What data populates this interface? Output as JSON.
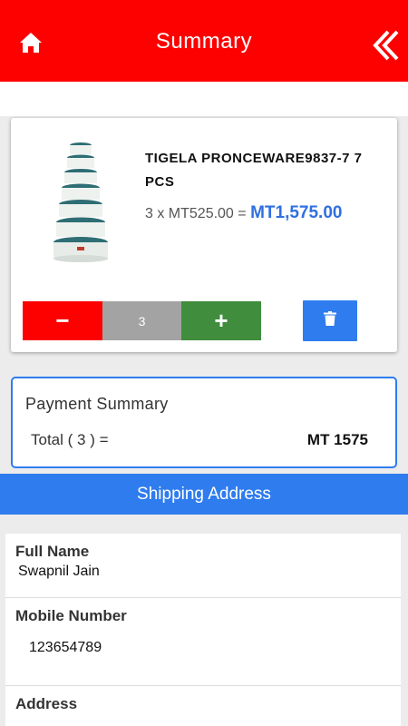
{
  "header": {
    "title": "Summary",
    "home_icon": "home-icon",
    "back_icon": "chevron-left-double-icon",
    "color": "#fd0101"
  },
  "cart": {
    "items": [
      {
        "name": "TIGELA PRONCEWARE9837-7 7 PCS",
        "quantity": "3",
        "unit_price_text": "3 x MT525.00 = ",
        "line_total": "MT1,575.00",
        "image_icon": "stacked-bowls-image"
      }
    ],
    "minus_label": "−",
    "plus_label": "+",
    "delete_icon": "trash-icon"
  },
  "payment_summary": {
    "heading": "Payment Summary",
    "total_label": "Total ( 3 ) =",
    "total_value": "MT 1575"
  },
  "shipping": {
    "heading": "Shipping Address",
    "fields": [
      {
        "label": "Full Name",
        "value": "Swapnil Jain"
      },
      {
        "label": "Mobile Number",
        "value": "123654789"
      },
      {
        "label": "Address",
        "value": ""
      }
    ]
  },
  "colors": {
    "accent_blue": "#2f7cee",
    "minus_red": "#fd0101",
    "qty_gray": "#a3a3a3",
    "plus_green": "#3f8d3d"
  }
}
